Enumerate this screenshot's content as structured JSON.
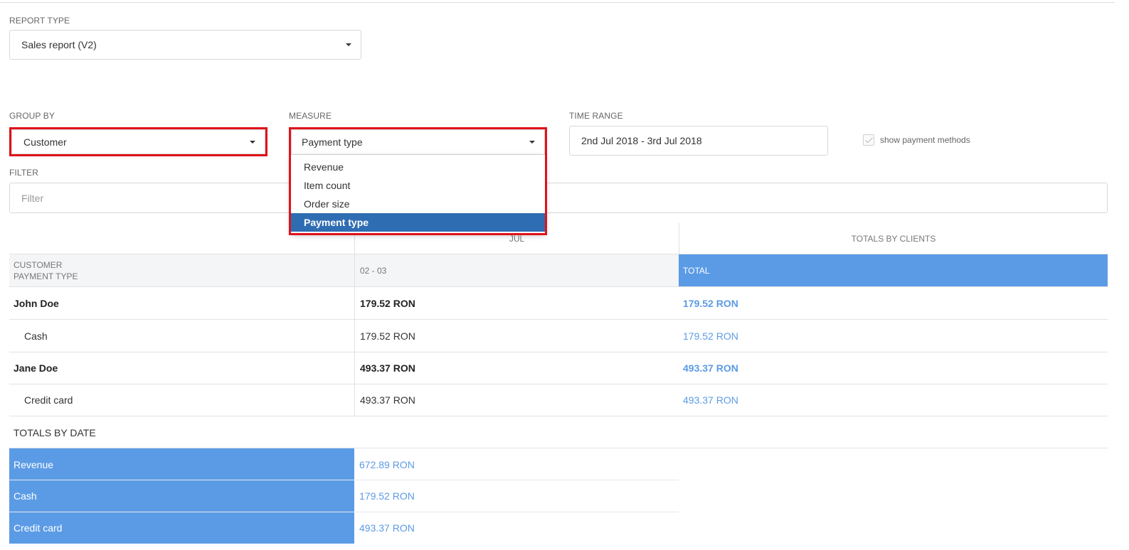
{
  "report_type": {
    "label": "REPORT TYPE",
    "value": "Sales report (V2)"
  },
  "group_by": {
    "label": "GROUP BY",
    "value": "Customer"
  },
  "measure": {
    "label": "MEASURE",
    "value": "Payment type",
    "options": [
      "Revenue",
      "Item count",
      "Order size",
      "Payment type"
    ],
    "selected_index": 3
  },
  "time_range": {
    "label": "TIME RANGE",
    "value": "2nd Jul  2018 - 3rd Jul  2018"
  },
  "show_payment_methods": {
    "label": "show payment methods",
    "checked": true
  },
  "filter": {
    "label": "FILTER",
    "placeholder": "Filter"
  },
  "table": {
    "month_header": "JUL",
    "totals_by_clients_header": "TOTALS BY CLIENTS",
    "row_header_line1": "CUSTOMER",
    "row_header_line2": "PAYMENT TYPE",
    "date_header": "02 - 03",
    "total_header": "TOTAL",
    "rows": [
      {
        "name": "John Doe",
        "value": "179.52 RON",
        "total": "179.52 RON",
        "bold": true
      },
      {
        "name": "Cash",
        "value": "179.52 RON",
        "total": "179.52 RON",
        "bold": false
      },
      {
        "name": "Jane Doe",
        "value": "493.37 RON",
        "total": "493.37 RON",
        "bold": true
      },
      {
        "name": "Credit card",
        "value": "493.37 RON",
        "total": "493.37 RON",
        "bold": false
      }
    ],
    "totals_by_date_label": "TOTALS BY DATE",
    "totals": [
      {
        "name": "Revenue",
        "value": "672.89 RON"
      },
      {
        "name": "Cash",
        "value": "179.52 RON"
      },
      {
        "name": "Credit card",
        "value": "493.37 RON"
      }
    ]
  },
  "colors": {
    "accent_blue": "#5b9be6",
    "highlight_red": "#e0121a",
    "selected_option": "#2f6db3"
  }
}
